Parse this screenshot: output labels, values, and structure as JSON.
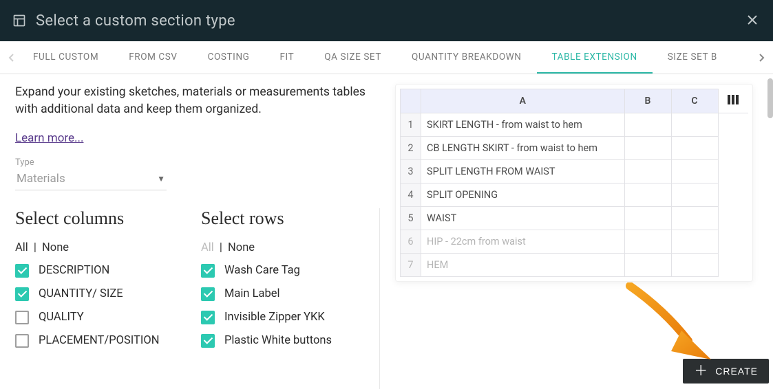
{
  "header": {
    "title": "Select a custom section type"
  },
  "tabs": {
    "items": [
      {
        "label": "FULL CUSTOM",
        "active": false
      },
      {
        "label": "FROM CSV",
        "active": false
      },
      {
        "label": "COSTING",
        "active": false
      },
      {
        "label": "FIT",
        "active": false
      },
      {
        "label": "QA SIZE SET",
        "active": false
      },
      {
        "label": "QUANTITY BREAKDOWN",
        "active": false
      },
      {
        "label": "TABLE EXTENSION",
        "active": true
      },
      {
        "label": "SIZE SET B",
        "active": false
      }
    ]
  },
  "description": "Expand your existing sketches, materials or measurements tables with additional data and keep them organized.",
  "learn_more": "Learn more...",
  "type_field": {
    "label": "Type",
    "value": "Materials"
  },
  "columns_section": {
    "heading": "Select columns",
    "all": "All",
    "none": "None",
    "items": [
      {
        "label": "DESCRIPTION",
        "checked": true
      },
      {
        "label": "QUANTITY/ SIZE",
        "checked": true
      },
      {
        "label": "QUALITY",
        "checked": false
      },
      {
        "label": "PLACEMENT/POSITION",
        "checked": false
      }
    ]
  },
  "rows_section": {
    "heading": "Select rows",
    "all": "All",
    "none": "None",
    "items": [
      {
        "label": "Wash Care Tag",
        "checked": true
      },
      {
        "label": "Main Label",
        "checked": true
      },
      {
        "label": "Invisible Zipper YKK",
        "checked": true
      },
      {
        "label": "Plastic White buttons",
        "checked": true
      }
    ]
  },
  "preview_table": {
    "headers": [
      "",
      "A",
      "B",
      "C"
    ],
    "rows": [
      {
        "n": "1",
        "a": "SKIRT LENGTH - from waist to hem",
        "muted": false
      },
      {
        "n": "2",
        "a": "CB LENGTH SKIRT - from waist to hem",
        "muted": false
      },
      {
        "n": "3",
        "a": "SPLIT LENGTH FROM WAIST",
        "muted": false
      },
      {
        "n": "4",
        "a": "SPLIT OPENING",
        "muted": false
      },
      {
        "n": "5",
        "a": "WAIST",
        "muted": false
      },
      {
        "n": "6",
        "a": "HIP - 22cm from waist",
        "muted": true
      },
      {
        "n": "7",
        "a": "HEM",
        "muted": true
      }
    ]
  },
  "create_label": "CREATE"
}
